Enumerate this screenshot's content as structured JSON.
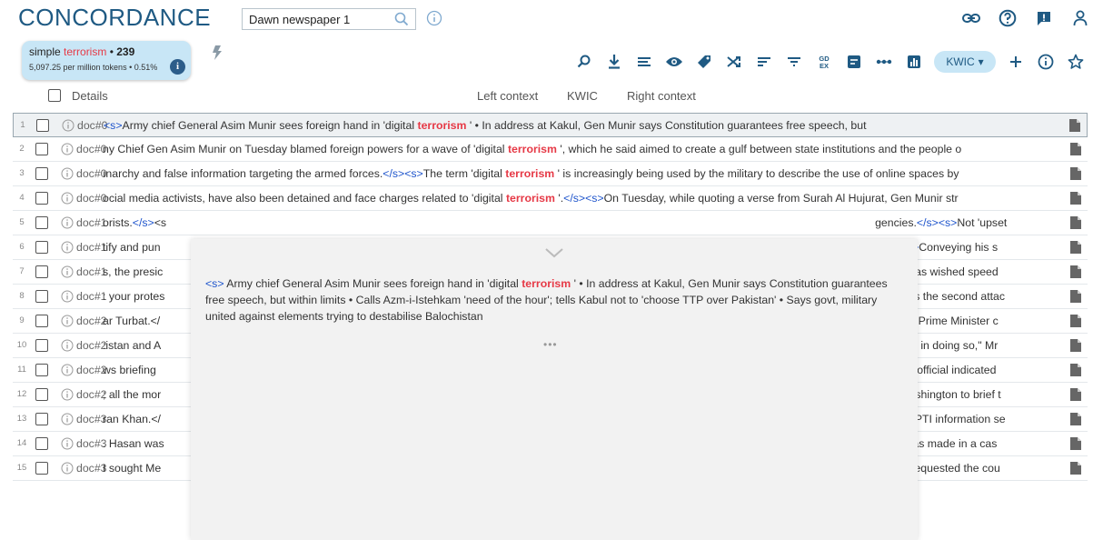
{
  "app": {
    "title": "CONCORDANCE"
  },
  "search": {
    "value": "Dawn newspaper 1"
  },
  "top_icons": [
    "link-icon",
    "help-icon",
    "feedback-icon",
    "user-icon"
  ],
  "query": {
    "prefix": "simple ",
    "term": "terrorism",
    "separator": " • ",
    "count": "239",
    "stats": "5,097.25 per million tokens • 0.51%"
  },
  "toolbar": {
    "icons": [
      "search-refine-icon",
      "download-icon",
      "lines-icon",
      "view-icon",
      "tag-icon",
      "shuffle-icon",
      "sort-icon",
      "filter-icon",
      "gdex-icon",
      "text-type-icon",
      "collocation-icon",
      "frequency-chart-icon"
    ],
    "view_select": "KWIC",
    "extra_icons": [
      "add-icon",
      "info-icon",
      "star-icon"
    ]
  },
  "table": {
    "headers": {
      "details": "Details",
      "left": "Left context",
      "kwic": "KWIC",
      "right": "Right context"
    },
    "rows": [
      {
        "num": "1",
        "doc": "doc#0",
        "pre": "<s>",
        "left": "Army chief General Asim Munir sees foreign hand in 'digital ",
        "kw": "terrorism",
        "right": " ' • In address at Kakul, Gen Munir says Constitution guarantees free speech, but"
      },
      {
        "num": "2",
        "doc": "doc#0",
        "pre": "",
        "left": "ny Chief Gen Asim Munir on Tuesday blamed foreign powers for a wave of 'digital ",
        "kw": "terrorism",
        "right": " ', which he said aimed to create a gulf between state institutions and the people o"
      },
      {
        "num": "3",
        "doc": "doc#0",
        "pre": "",
        "left": "ınarchy and false information targeting the armed forces.</s><s>The term 'digital ",
        "kw": "terrorism",
        "right": " ' is increasingly being used by the military to describe the use of online spaces by"
      },
      {
        "num": "4",
        "doc": "doc#0",
        "pre": "",
        "left": "ocial media activists, have also been detained and face charges related to 'digital ",
        "kw": "terrorism",
        "right": " '.</s><s>On Tuesday, while quoting a verse from Surah Al Hujurat, Gen Munir str"
      },
      {
        "num": "5",
        "doc": "doc#1",
        "pre": "",
        "left": "orists.</s><s",
        "kw": "",
        "right": "gencies.</s><s>Not 'upset"
      },
      {
        "num": "6",
        "doc": "doc#1",
        "pre": "",
        "left": "tify and pun",
        "kw": "",
        "right": "ıt.</s><s>Conveying his s"
      },
      {
        "num": "7",
        "doc": "doc#1",
        "pre": "",
        "left": "s, the presic",
        "kw": "",
        "right": ", as well as wished speed"
      },
      {
        "num": "8",
        "doc": "doc#1",
        "pre": "",
        "left": ": your protes",
        "kw": "",
        "right": "ks This is the second attac"
      },
      {
        "num": "9",
        "doc": "doc#2",
        "pre": "",
        "left": "ar Turbat.</",
        "kw": "",
        "right": "INGTON: Prime Minister c"
      },
      {
        "num": "10",
        "doc": "doc#2",
        "pre": "",
        "left": ":istan and A",
        "kw": "",
        "right": "t succeed in doing so,\" Mr"
      },
      {
        "num": "11",
        "doc": "doc#2",
        "pre": "",
        "left": "ws briefing",
        "kw": "",
        "right": "senior US official indicated"
      },
      {
        "num": "12",
        "doc": "doc#2",
        "pre": "",
        "left": "; all the mor",
        "kw": "",
        "right": "siting Washington to brief t"
      },
      {
        "num": "13",
        "doc": "doc#3",
        "pre": "",
        "left": "ran Khan.</",
        "kw": "",
        "right": "day sent PTI information se"
      },
      {
        "num": "14",
        "doc": "doc#3",
        "pre": "",
        "left": ". Hasan was",
        "kw": "",
        "right": "arrest was made in a cas"
      },
      {
        "num": "15",
        "doc": "doc#3",
        "pre": "",
        "left": "I sought Me",
        "kw": "",
        "right": "Bukhari requested the cou"
      }
    ]
  },
  "detail_popup": {
    "tag": "<s>",
    "before": " Army chief General Asim Munir sees foreign hand in 'digital ",
    "kw": "terrorism",
    "after": " ' • In address at Kakul, Gen Munir says Constitution guarantees free speech, but within limits • Calls Azm-i-Istehkam 'need of the hour'; tells Kabul not to 'choose TTP over Pakistan' • Says govt, military united against elements trying to destabilise Balochistan",
    "more": "•••"
  },
  "colors": {
    "brand": "#1f5a83",
    "keyword": "#e63946",
    "tag": "#1f55cc",
    "chip": "#c8e6f6"
  }
}
